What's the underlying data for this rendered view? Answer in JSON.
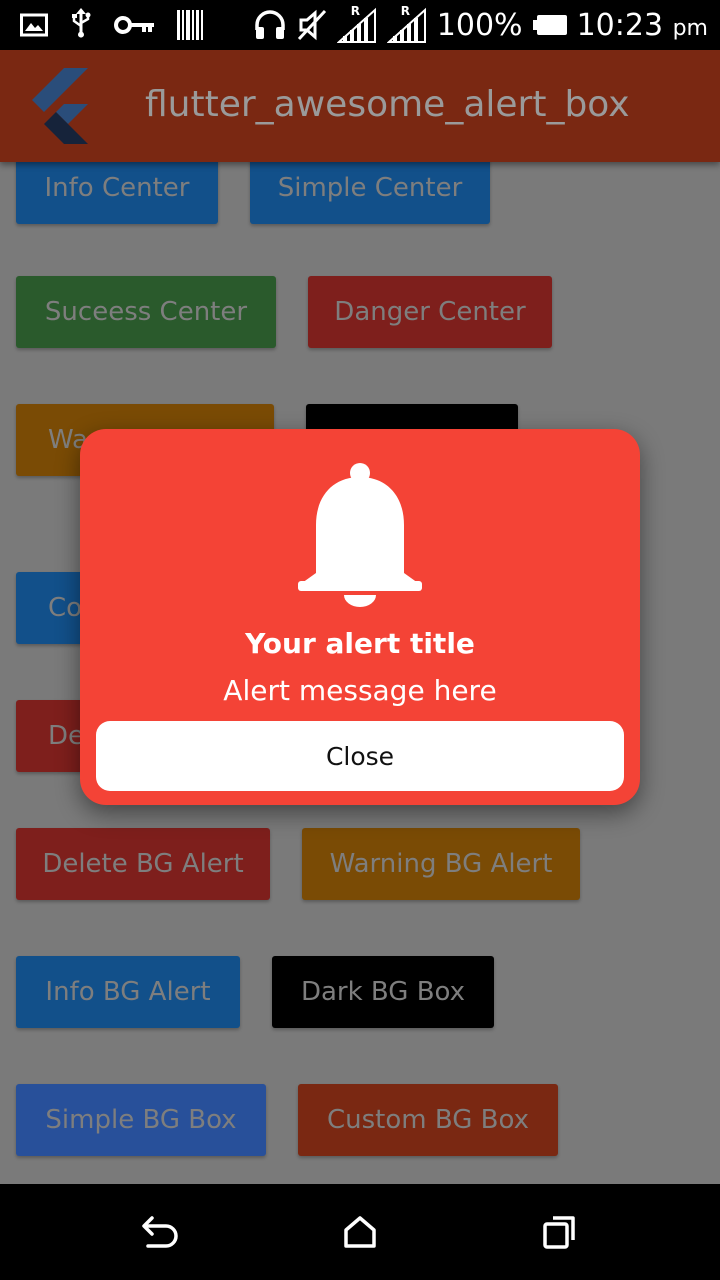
{
  "status_bar": {
    "icons": [
      "image-icon",
      "usb-icon",
      "key-icon",
      "barcode-icon",
      "headset-icon",
      "mute-icon",
      "signal-icon",
      "signal-icon"
    ],
    "roaming_marker": "R",
    "battery": "100%",
    "time": "10:23",
    "time_suffix": "pm"
  },
  "app_bar": {
    "title": "flutter_awesome_alert_box",
    "logo_icon": "flutter-logo-icon"
  },
  "buttons": {
    "info_center": "Info Center",
    "simple_center": "Simple Center",
    "success_center": "Suceess Center",
    "danger_center": "Danger Center",
    "warning_partial": "Wa",
    "confirm_partial": "Co",
    "delete_partial": "De",
    "delete_bg_alert": "Delete BG Alert",
    "warning_bg_alert": "Warning BG Alert",
    "info_bg_alert": "Info BG Alert",
    "dark_bg_box": "Dark BG Box",
    "simple_bg_box": "Simple BG Box",
    "custom_bg_box": "Custom BG Box"
  },
  "alert": {
    "icon": "bell-icon",
    "title": "Your alert title",
    "message": "Alert message here",
    "close_label": "Close",
    "color": "#f44336"
  },
  "nav_bar": {
    "icons": [
      "back-icon",
      "home-icon",
      "recent-apps-icon"
    ]
  },
  "colors": {
    "app_bar": "#7a2812",
    "scrim_background": "#7a7a7a",
    "alert": "#f44336"
  }
}
